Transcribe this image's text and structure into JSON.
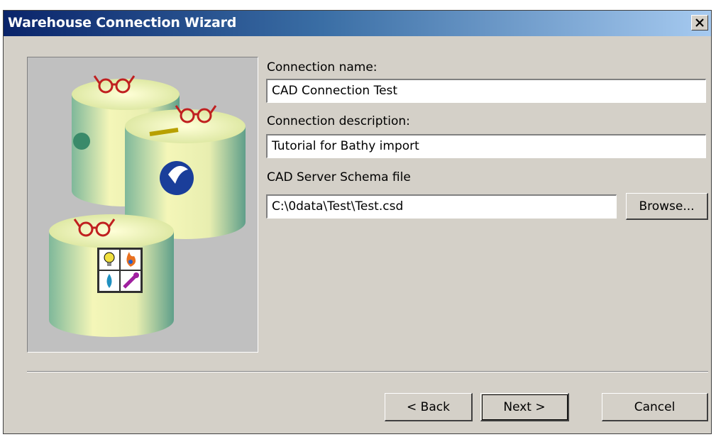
{
  "window": {
    "title": "Warehouse Connection Wizard"
  },
  "form": {
    "connection_name_label": "Connection name:",
    "connection_name_value": "CAD Connection Test",
    "connection_description_label": "Connection description:",
    "connection_description_value": "Tutorial for Bathy import",
    "schema_file_label": "CAD Server Schema file",
    "schema_file_value": "C:\\0data\\Test\\Test.csd",
    "browse_label": "Browse..."
  },
  "footer": {
    "back_label": "< Back",
    "next_label": "Next >",
    "cancel_label": "Cancel"
  },
  "icons": [
    "close-icon",
    "database-icon",
    "glasses-icon",
    "globe-icon",
    "logo-icon",
    "lightbulb-icon",
    "flame-icon",
    "droplet-icon",
    "wrench-icon"
  ]
}
